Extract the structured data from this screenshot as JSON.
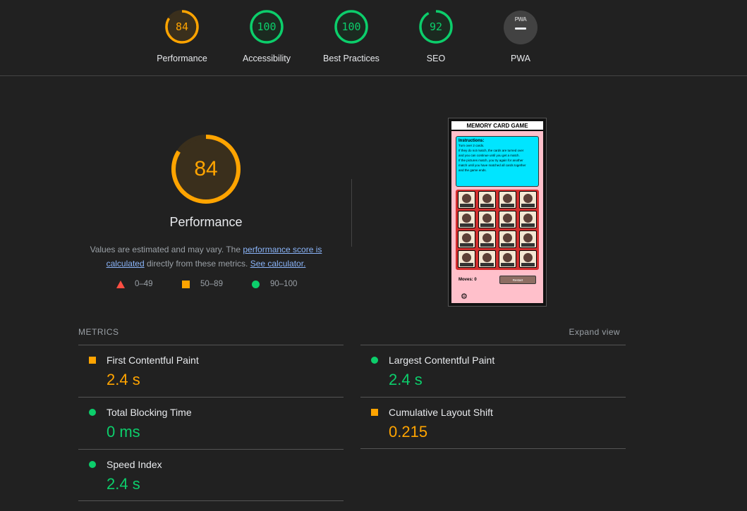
{
  "colors": {
    "average": "#ffa400",
    "pass": "#0cce6b",
    "fail": "#ff4e42",
    "na": "#424242",
    "background": "#212121"
  },
  "gauges": [
    {
      "label": "Performance",
      "score": "84",
      "color": "#ffa400",
      "fraction": 0.84
    },
    {
      "label": "Accessibility",
      "score": "100",
      "color": "#0cce6b",
      "fraction": 1.0
    },
    {
      "label": "Best Practices",
      "score": "100",
      "color": "#0cce6b",
      "fraction": 1.0
    },
    {
      "label": "SEO",
      "score": "92",
      "color": "#0cce6b",
      "fraction": 0.92
    }
  ],
  "pwa": {
    "label": "PWA",
    "badge_text": "PWA"
  },
  "main_score": {
    "score": "84",
    "fraction": 0.84,
    "title": "Performance",
    "desc_before": "Values are estimated and may vary. The ",
    "desc_link1": "performance score is calculated",
    "desc_middle": " directly from these metrics. ",
    "desc_link2": "See calculator."
  },
  "legend": [
    {
      "shape": "triangle",
      "range": "0–49"
    },
    {
      "shape": "square",
      "range": "50–89"
    },
    {
      "shape": "circle",
      "range": "90–100"
    }
  ],
  "screenshot": {
    "title": "MEMORY CARD GAME",
    "instructions_heading": "Instructions:",
    "instructions_lines": [
      "Turn over 2 cards.",
      "If they do not match, the cards are turned over",
      "and you can continue until you get a match.",
      "If the pictures match, you try again for another",
      "match until you have matched all cards together",
      "and the game ends."
    ],
    "moves": "Moves: 0",
    "restart": "Restart"
  },
  "metrics": {
    "heading": "METRICS",
    "expand_label": "Expand view",
    "items": [
      {
        "name": "First Contentful Paint",
        "value": "2.4 s",
        "rating": "average"
      },
      {
        "name": "Largest Contentful Paint",
        "value": "2.4 s",
        "rating": "pass"
      },
      {
        "name": "Total Blocking Time",
        "value": "0 ms",
        "rating": "pass"
      },
      {
        "name": "Cumulative Layout Shift",
        "value": "0.215",
        "rating": "average"
      },
      {
        "name": "Speed Index",
        "value": "2.4 s",
        "rating": "pass"
      }
    ]
  }
}
